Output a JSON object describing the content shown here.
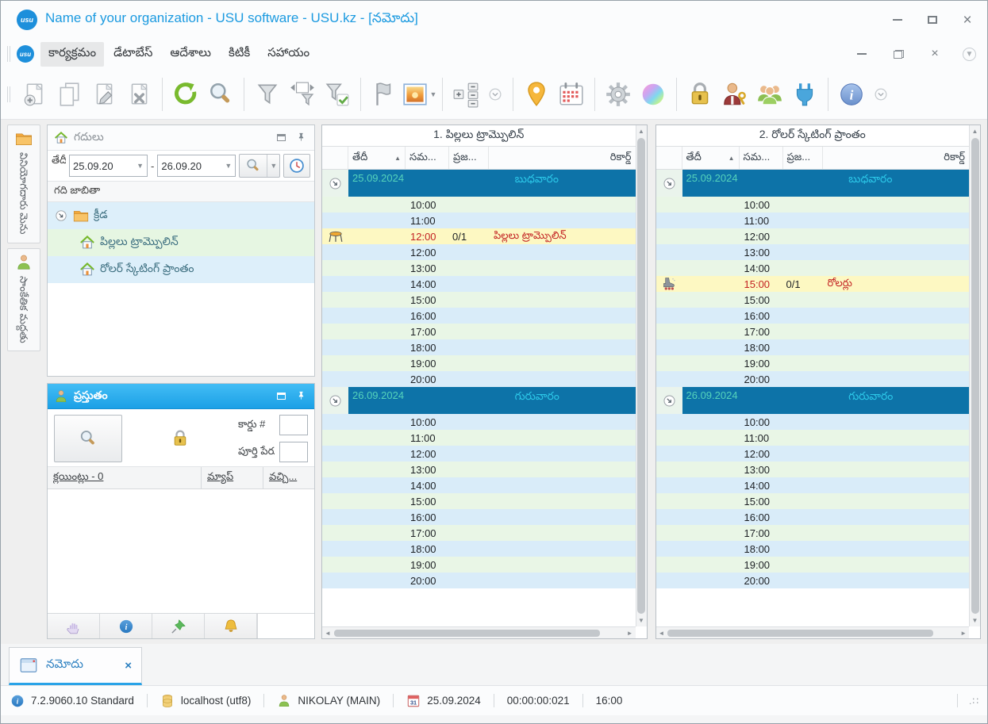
{
  "window": {
    "title": "Name of your organization - USU software - USU.kz - [నమోదు]",
    "logo_text": "usu"
  },
  "menu": {
    "active_index": 0,
    "items": [
      "కార్యక్రమం",
      "డేటాబేస్",
      "ఆదేశాలు",
      "కిటికీ",
      "సహాయం"
    ]
  },
  "toolbar": {
    "groups": [
      [
        "new-record",
        "copy-record",
        "edit-record",
        "delete-record"
      ],
      [
        "refresh",
        "search"
      ],
      [
        "filter",
        "filter-window",
        "filter-saved"
      ],
      [
        "flag",
        "image-gallery"
      ],
      [
        "row-scale",
        "toolbar-overflow"
      ],
      [
        "map-pin",
        "calendar"
      ],
      [
        "settings",
        "color-theme"
      ],
      [
        "lock",
        "user-permissions",
        "users",
        "integrations"
      ],
      [
        "about",
        "toolbar-overflow"
      ]
    ]
  },
  "sidebar_tabs": [
    {
      "label": "వినియోగదారు మెను",
      "icon": "folder"
    },
    {
      "label": "సాంకేతిక మద్దతు",
      "icon": "person"
    }
  ],
  "rooms_panel": {
    "title": "గదులు",
    "date_label": "తేదీ",
    "date_from": "25.09.20",
    "date_to": "26.09.20",
    "list_header": "గది జాబితా",
    "tree": [
      {
        "label": "క్రీడ",
        "icon": "folder",
        "level": 0,
        "shade": "blue"
      },
      {
        "label": "పిల్లలు ట్రామ్పొలిన్",
        "icon": "home",
        "level": 1,
        "shade": "green"
      },
      {
        "label": "రోలర్ స్కేటింగ్ ప్రాంతం",
        "icon": "home",
        "level": 1,
        "shade": "blue"
      }
    ]
  },
  "current_panel": {
    "title": "ప్రస్తుతం",
    "card_label": "కార్డు #",
    "card_value": "",
    "name_label": "పూర్తి పేరు",
    "name_value": "",
    "table_headers": [
      "క్లయింట్లు - 0",
      "మ్యాప్",
      "వచ్చి..."
    ]
  },
  "schedules": [
    {
      "title": "1. పిల్లలు ట్రామ్పొలిన్",
      "columns": {
        "date": "తేదీ",
        "time": "సమ...",
        "people": "ప్రజ...",
        "record": "రికార్డ్"
      },
      "groups": [
        {
          "date": "25.09.2024",
          "weekday": "బుధవారం",
          "rows": [
            {
              "time": "10:00",
              "shade": "green"
            },
            {
              "time": "11:00",
              "shade": "blue"
            },
            {
              "time": "12:00",
              "shade": "yellow",
              "booked": true,
              "count": "0/1",
              "record": "పిల్లలు ట్రామ్పొలిన్",
              "icon": "trampoline"
            },
            {
              "time": "12:00",
              "shade": "blue"
            },
            {
              "time": "13:00",
              "shade": "green"
            },
            {
              "time": "14:00",
              "shade": "blue"
            },
            {
              "time": "15:00",
              "shade": "green"
            },
            {
              "time": "16:00",
              "shade": "blue"
            },
            {
              "time": "17:00",
              "shade": "green"
            },
            {
              "time": "18:00",
              "shade": "blue"
            },
            {
              "time": "19:00",
              "shade": "green"
            },
            {
              "time": "20:00",
              "shade": "blue"
            }
          ]
        },
        {
          "date": "26.09.2024",
          "weekday": "గురువారం",
          "rows": [
            {
              "time": "10:00",
              "shade": "blue"
            },
            {
              "time": "11:00",
              "shade": "green"
            },
            {
              "time": "12:00",
              "shade": "blue"
            },
            {
              "time": "13:00",
              "shade": "green"
            },
            {
              "time": "14:00",
              "shade": "blue"
            },
            {
              "time": "15:00",
              "shade": "green"
            },
            {
              "time": "16:00",
              "shade": "blue"
            },
            {
              "time": "17:00",
              "shade": "green"
            },
            {
              "time": "18:00",
              "shade": "blue"
            },
            {
              "time": "19:00",
              "shade": "green"
            },
            {
              "time": "20:00",
              "shade": "blue"
            }
          ]
        }
      ]
    },
    {
      "title": "2. రోలర్ స్కేటింగ్ ప్రాంతం",
      "columns": {
        "date": "తేదీ",
        "time": "సమ...",
        "people": "ప్రజ...",
        "record": "రికార్డ్"
      },
      "groups": [
        {
          "date": "25.09.2024",
          "weekday": "బుధవారం",
          "rows": [
            {
              "time": "10:00",
              "shade": "green"
            },
            {
              "time": "11:00",
              "shade": "blue"
            },
            {
              "time": "12:00",
              "shade": "green"
            },
            {
              "time": "13:00",
              "shade": "blue"
            },
            {
              "time": "14:00",
              "shade": "green"
            },
            {
              "time": "15:00",
              "shade": "yellow",
              "booked": true,
              "count": "0/1",
              "record": "రోలర్లు",
              "icon": "roller"
            },
            {
              "time": "15:00",
              "shade": "green"
            },
            {
              "time": "16:00",
              "shade": "blue"
            },
            {
              "time": "17:00",
              "shade": "green"
            },
            {
              "time": "18:00",
              "shade": "blue"
            },
            {
              "time": "19:00",
              "shade": "green"
            },
            {
              "time": "20:00",
              "shade": "blue"
            }
          ]
        },
        {
          "date": "26.09.2024",
          "weekday": "గురువారం",
          "rows": [
            {
              "time": "10:00",
              "shade": "blue"
            },
            {
              "time": "11:00",
              "shade": "green"
            },
            {
              "time": "12:00",
              "shade": "blue"
            },
            {
              "time": "13:00",
              "shade": "green"
            },
            {
              "time": "14:00",
              "shade": "blue"
            },
            {
              "time": "15:00",
              "shade": "green"
            },
            {
              "time": "16:00",
              "shade": "blue"
            },
            {
              "time": "17:00",
              "shade": "green"
            },
            {
              "time": "18:00",
              "shade": "blue"
            },
            {
              "time": "19:00",
              "shade": "green"
            },
            {
              "time": "20:00",
              "shade": "blue"
            }
          ]
        }
      ]
    }
  ],
  "footer": {
    "tab_label": "నమోదు"
  },
  "status_bar": {
    "version": "7.2.9060.10 Standard",
    "database": "localhost (utf8)",
    "user": "NIKOLAY (MAIN)",
    "calendar_day": "31",
    "date": "25.09.2024",
    "timer": "00:00:00:021",
    "time": "16:00"
  },
  "colors": {
    "accent_blue": "#1b9ae0",
    "panel_header_blue": "#2eaef0",
    "group_row_bg": "#0d73a8",
    "group_date_text": "#55d3bb",
    "group_weekday_text": "#2cc7e8",
    "row_green": "#e9f6e6",
    "row_blue": "#d9ecf9",
    "booked_bg": "#fdf8c2",
    "booked_text": "#c32323"
  }
}
